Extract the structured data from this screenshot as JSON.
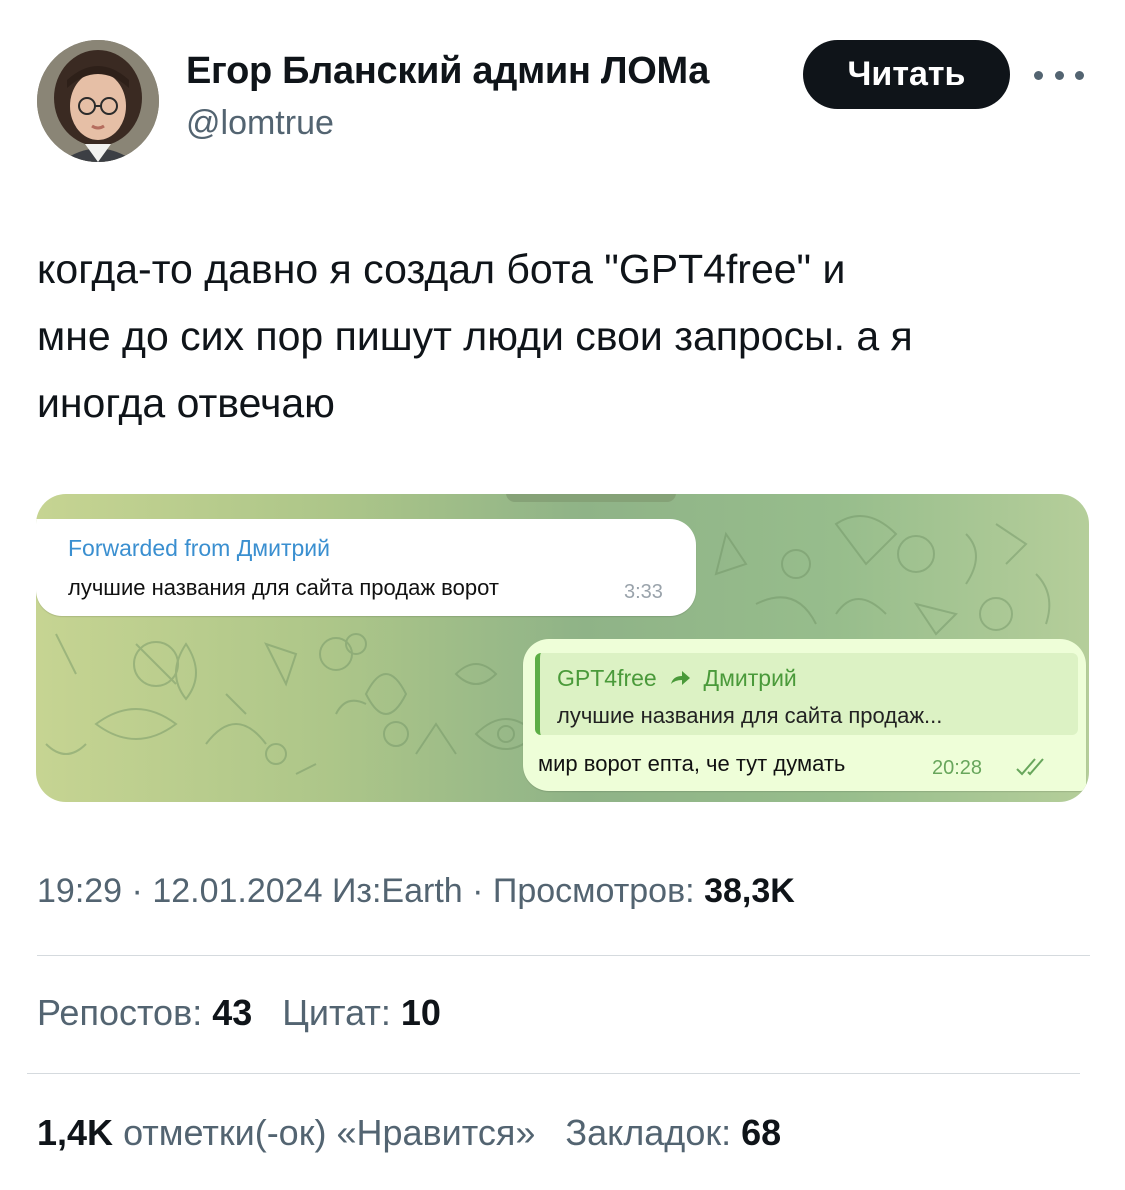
{
  "author": {
    "name": "Егор Бланский админ ЛОМа",
    "handle": "@lomtrue",
    "follow_label": "Читать"
  },
  "tweet": {
    "lines": [
      "когда-то давно я создал бота \"GPT4free\" и",
      "мне до сих пор пишут люди свои запросы. а я",
      "иногда отвечаю"
    ]
  },
  "media": {
    "incoming": {
      "forwarded_label": "Forwarded from Дмитрий",
      "text": "лучшие названия для сайта продаж ворот",
      "time": "3:33"
    },
    "outgoing": {
      "reply_from": "GPT4free",
      "reply_to": "Дмитрий",
      "reply_text": "лучшие названия для сайта продаж...",
      "text": "мир ворот епта, че тут думать",
      "time": "20:28"
    }
  },
  "meta": {
    "time": "19:29",
    "separator": " · ",
    "date": "12.01.2024",
    "source": "Из:Earth",
    "views_label": "Просмотров:",
    "views_value": "38,3K"
  },
  "stats": {
    "reposts_label": "Репостов:",
    "reposts_value": "43",
    "quotes_label": "Цитат:",
    "quotes_value": "10",
    "likes_value": "1,4K",
    "likes_label": "отметки(-ок) «Нравится»",
    "bookmarks_label": "Закладок:",
    "bookmarks_value": "68"
  },
  "colors": {
    "text": "#0f1419",
    "secondary": "#536471",
    "button": "#0f1419",
    "telegram_link": "#3a8fd0",
    "telegram_out_bubble": "#eefed8",
    "telegram_reply_accent": "#5cae45"
  }
}
